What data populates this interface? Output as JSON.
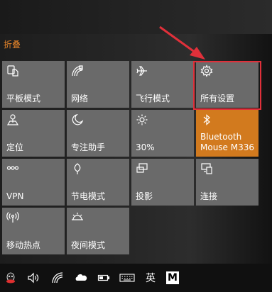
{
  "action_center": {
    "collapse_label": "折叠",
    "tiles": [
      {
        "label": "平板模式",
        "icon": "tablet-mode-icon"
      },
      {
        "label": "网络",
        "icon": "network-icon"
      },
      {
        "label": "飞行模式",
        "icon": "airplane-icon"
      },
      {
        "label": "所有设置",
        "icon": "gear-icon"
      },
      {
        "label": "定位",
        "icon": "location-icon"
      },
      {
        "label": "专注助手",
        "icon": "moon-icon"
      },
      {
        "label": "30%",
        "icon": "brightness-icon"
      },
      {
        "label": "Bluetooth",
        "label2": "Mouse M336",
        "icon": "bluetooth-icon",
        "active": true
      },
      {
        "label": "VPN",
        "icon": "vpn-icon"
      },
      {
        "label": "节电模式",
        "icon": "battery-saver-icon"
      },
      {
        "label": "投影",
        "icon": "project-icon"
      },
      {
        "label": "连接",
        "icon": "connect-icon"
      },
      {
        "label": "移动热点",
        "icon": "hotspot-icon"
      },
      {
        "label": "夜间模式",
        "icon": "night-light-icon"
      }
    ]
  },
  "colors": {
    "accent": "#d27a1e",
    "tile": "#6a6a6a",
    "highlight": "#e0303a",
    "collapse_text": "#e8862a"
  },
  "taskbar": {
    "icons": [
      "qq-icon",
      "volume-icon",
      "wifi-icon",
      "onedrive-icon",
      "battery-icon",
      "keyboard-icon",
      "ime-icon",
      "m-app-icon"
    ],
    "ime_label": "英",
    "m_label": "M"
  }
}
